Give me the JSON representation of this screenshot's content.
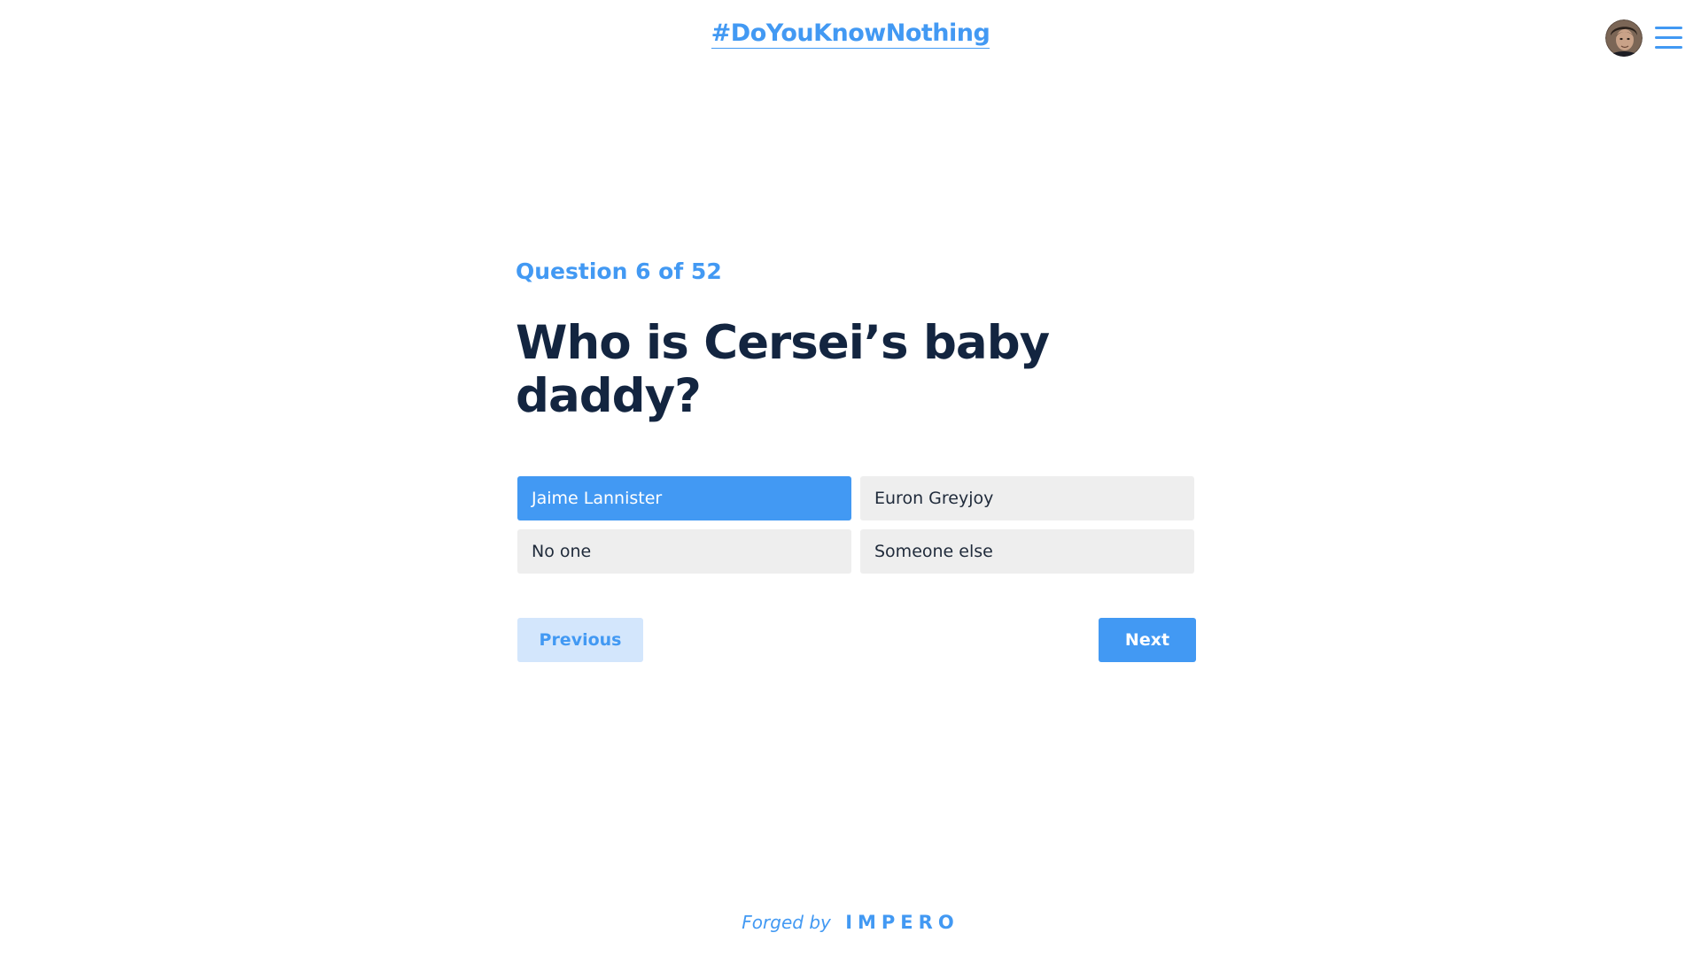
{
  "header": {
    "brand_hashtag": "#DoYouKnowNothing",
    "avatar_icon": "user-avatar",
    "menu_icon": "hamburger-menu-icon"
  },
  "quiz": {
    "progress_text": "Question 6 of 52",
    "question_text": "Who is Cersei’s baby daddy?",
    "answers": [
      {
        "label": "Jaime Lannister",
        "selected": true
      },
      {
        "label": "Euron Greyjoy",
        "selected": false
      },
      {
        "label": "No one",
        "selected": false
      },
      {
        "label": "Someone else",
        "selected": false
      }
    ],
    "previous_label": "Previous",
    "next_label": "Next"
  },
  "footer": {
    "forged_by": "Forged by",
    "company": "IMPERO"
  },
  "colors": {
    "accent": "#4299f3",
    "accent_light": "#d3e6fc",
    "heading": "#132540",
    "answer_bg": "#eeeeee"
  }
}
